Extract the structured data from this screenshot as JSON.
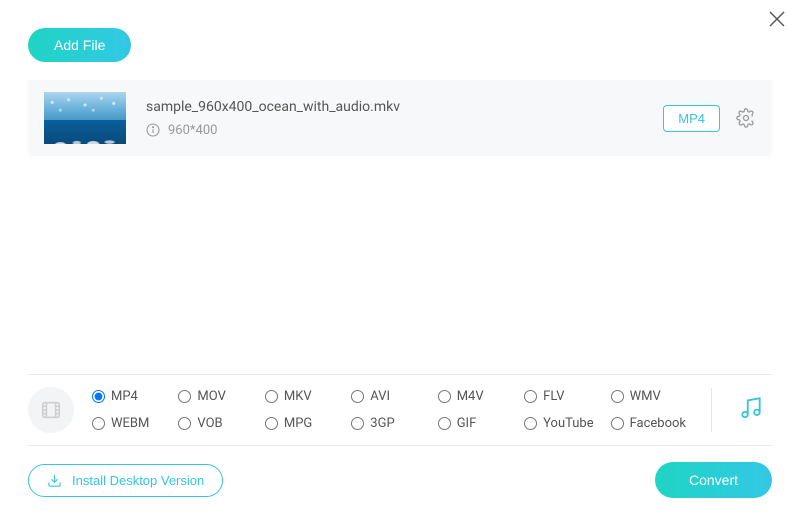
{
  "colors": {
    "accent": "#35c5dd",
    "gradient_a": "#1fd4c4",
    "gradient_b": "#33c8e6"
  },
  "header": {
    "add_file_label": "Add File",
    "close_icon": "close-icon"
  },
  "file_list": [
    {
      "name": "sample_960x400_ocean_with_audio.mkv",
      "resolution": "960*400",
      "output_format": "MP4"
    }
  ],
  "formats": {
    "selected": "MP4",
    "options": [
      "MP4",
      "MOV",
      "MKV",
      "AVI",
      "M4V",
      "FLV",
      "WMV",
      "WEBM",
      "VOB",
      "MPG",
      "3GP",
      "GIF",
      "YouTube",
      "Facebook"
    ]
  },
  "footer": {
    "install_label": "Install Desktop Version",
    "convert_label": "Convert"
  }
}
